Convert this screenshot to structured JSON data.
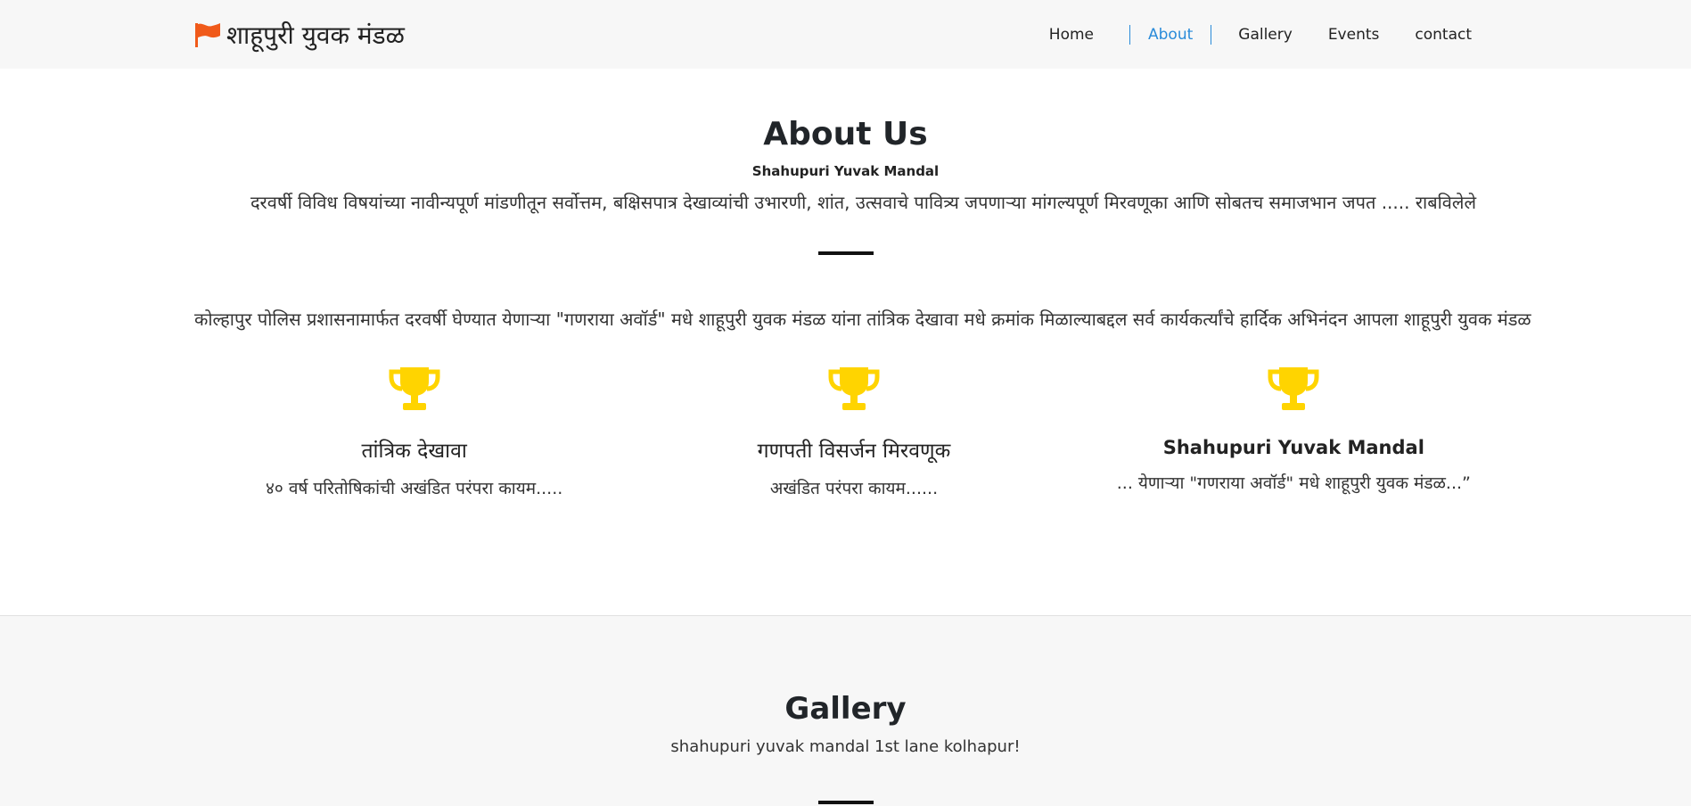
{
  "navbar": {
    "brand": "शाहूपुरी युवक मंडळ",
    "brand_icon": "flag-icon",
    "brand_color": "#f05a1a",
    "links": [
      "Home",
      "About",
      "Gallery",
      "Events",
      "contact"
    ],
    "active": "About",
    "active_color": "#2a8bd9"
  },
  "about": {
    "title": "About Us",
    "subtitle": "Shahupuri Yuvak Mandal",
    "tagline": "दरवर्षी विविध विषयांच्या नावीन्यपूर्ण मांडणीतून सर्वोत्तम, बक्षिसपात्र देखाव्यांची उभारणी, शांत, उत्सवाचे पावित्र्य जपणाऱ्या मांगल्यपूर्ण मिरवणूका आणि सोबतच समाजभान जपत ..... राबविलेले",
    "paragraph": "कोल्हापुर पोलिस प्रशासनामार्फत दरवर्षी घेण्यात येणाऱ्या \"गणराया अवॉर्ड\" मधे शाहूपुरी युवक मंडळ यांना तांत्रिक देखावा मधे क्रमांक मिळाल्याबद्दल सर्व कार्यकर्त्यांचे हार्दिक अभिनंदन आपला शाहूपुरी युवक मंडळ",
    "features": [
      {
        "icon": "trophy-icon",
        "title": "तांत्रिक देखावा",
        "text": "४० वर्ष परितोषिकांची अखंडित परंपरा कायम....."
      },
      {
        "icon": "trophy-icon",
        "title": "गणपती विसर्जन मिरवणूक",
        "text": "अखंडित परंपरा कायम......"
      },
      {
        "icon": "trophy-icon",
        "title": "Shahupuri Yuvak Mandal",
        "text": "... येणाऱ्या \"गणराया अवॉर्ड\" मधे शाहूपुरी युवक मंडळ...”"
      }
    ],
    "trophy_color": "#ffd400"
  },
  "gallery": {
    "title": "Gallery",
    "subtitle": "shahupuri yuvak mandal 1st lane kolhapur!"
  }
}
